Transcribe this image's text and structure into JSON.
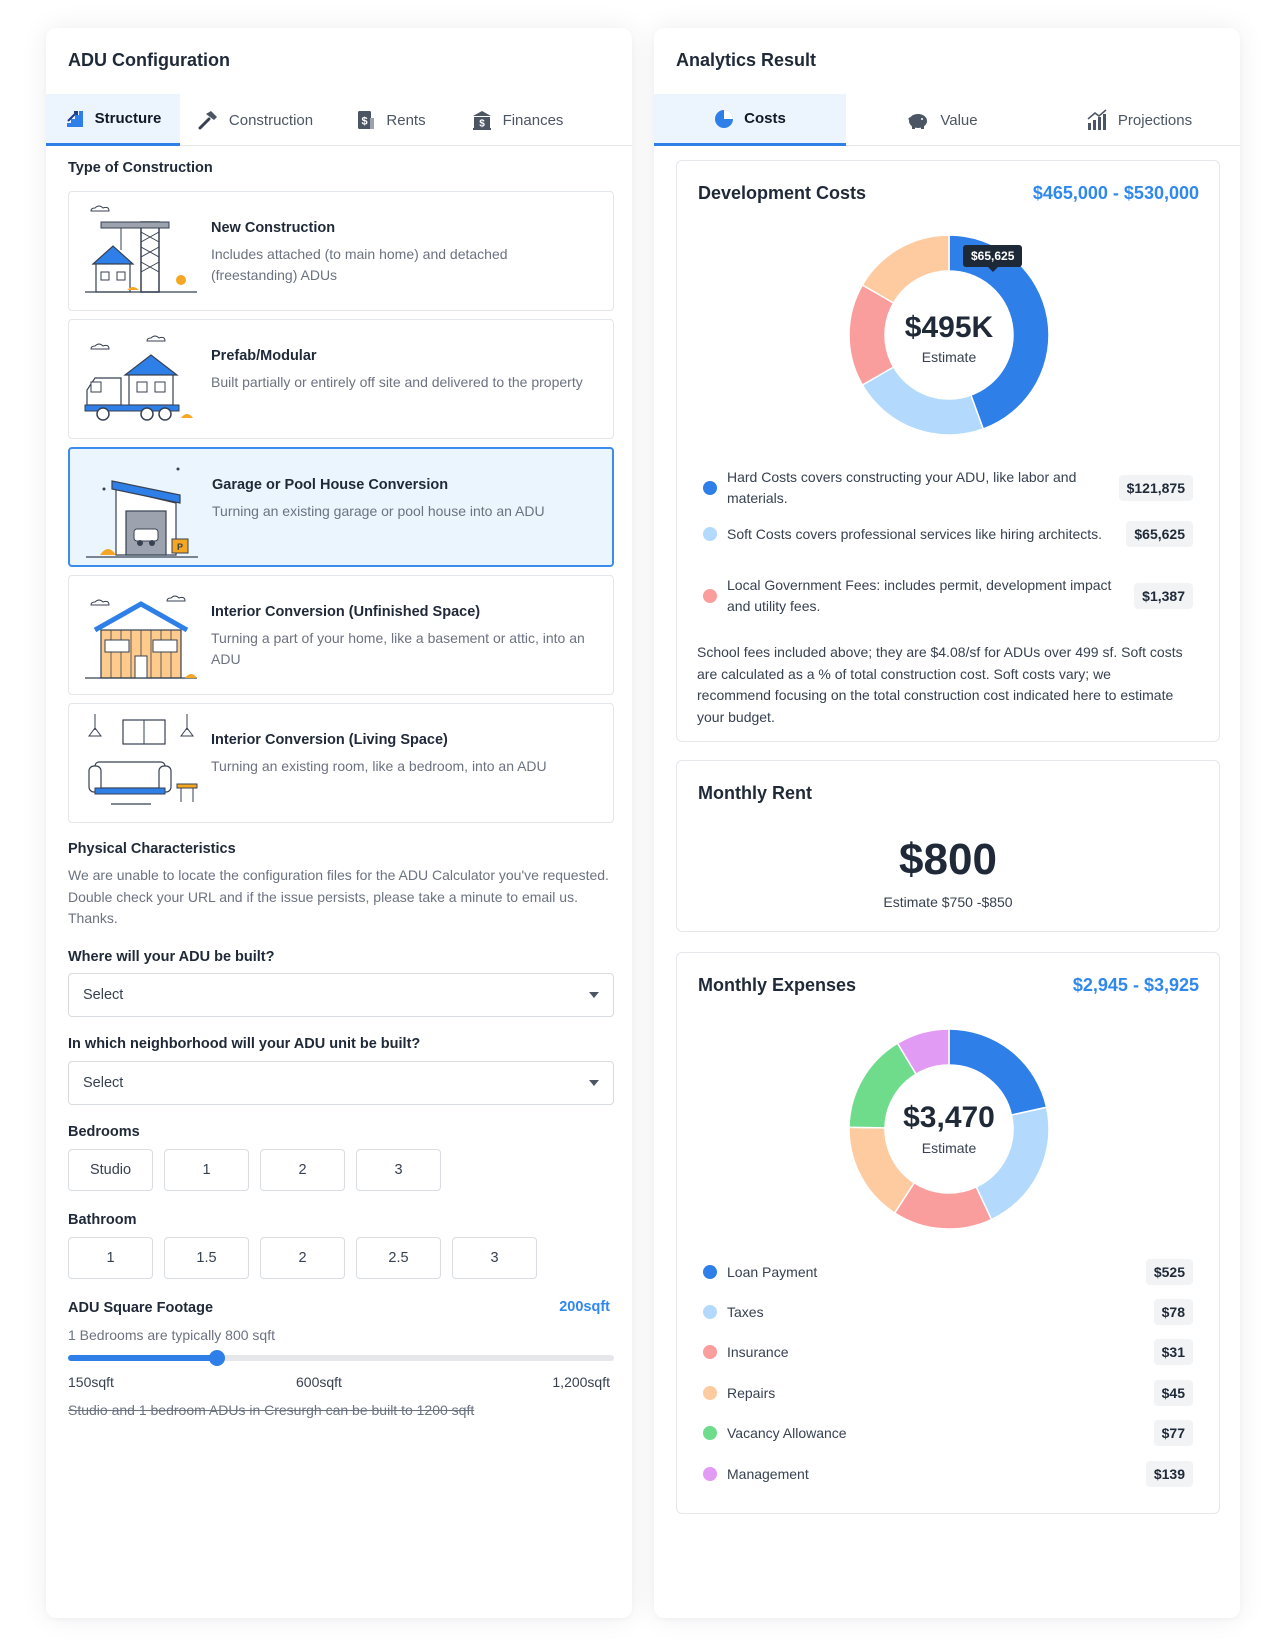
{
  "left": {
    "title": "ADU Configuration",
    "tabs": [
      {
        "label": "Structure",
        "icon": "stairs-icon"
      },
      {
        "label": "Construction",
        "icon": "hammer-icon"
      },
      {
        "label": "Rents",
        "icon": "dollar-document-icon"
      },
      {
        "label": "Finances",
        "icon": "bank-icon"
      }
    ],
    "type_label": "Type of Construction",
    "types": [
      {
        "title": "New Construction",
        "desc": "Includes attached (to main home) and detached (freestanding) ADUs"
      },
      {
        "title": "Prefab/Modular",
        "desc": "Built partially or entirely off site and delivered to the property"
      },
      {
        "title": "Garage or Pool House Conversion",
        "desc": "Turning an existing garage or pool house into an ADU"
      },
      {
        "title": "Interior Conversion (Unfinished Space)",
        "desc": "Turning a part of your home, like a basement or attic, into an ADU"
      },
      {
        "title": "Interior Conversion (Living Space)",
        "desc": "Turning an existing room, like a bedroom, into an ADU"
      }
    ],
    "physical_label": "Physical Characteristics",
    "physical_text": "We are unable to locate the configuration files for the ADU Calculator you've requested. Double check your URL and if the issue persists, please take a minute to email us. Thanks.",
    "where_label": "Where will your ADU be built?",
    "where_value": "Select",
    "neighborhood_label": "In which neighborhood will your ADU unit be built?",
    "neighborhood_value": "Select",
    "bedrooms_label": "Bedrooms",
    "bedrooms": [
      "Studio",
      "1",
      "2",
      "3"
    ],
    "bathroom_label": "Bathroom",
    "bathrooms": [
      "1",
      "1.5",
      "2",
      "2.5",
      "3"
    ],
    "sqft_label": "ADU Square Footage",
    "sqft_value": "200sqft",
    "sqft_hint": "1 Bedrooms are typically 800 sqft",
    "slider_fraction": 0.273,
    "slider_min": "150sqft",
    "slider_mid": "600sqft",
    "slider_max": "1,200sqft",
    "sqft_note": "Studio and 1 bedroom ADUs in Cresurgh can be built to 1200 sqft"
  },
  "right": {
    "title": "Analytics Result",
    "tabs": [
      {
        "label": "Costs",
        "icon": "pie-chart-icon"
      },
      {
        "label": "Value",
        "icon": "piggy-bank-icon"
      },
      {
        "label": "Projections",
        "icon": "bar-growth-icon"
      }
    ],
    "dev": {
      "title": "Development Costs",
      "range": "$465,000 - $530,000",
      "center_value": "$495K",
      "center_label": "Estimate",
      "tooltip": "$65,625",
      "items": [
        {
          "text": "Hard Costs covers constructing your ADU, like labor and materials.",
          "amount": "$121,875",
          "color": "#2f7fe8"
        },
        {
          "text": "Soft Costs covers professional services like hiring architects.",
          "amount": "$65,625",
          "color": "#b3dafc"
        },
        {
          "text": "Local Government Fees: includes permit, development impact and utility fees.",
          "amount": "$1,387",
          "color": "#fa9d9d"
        }
      ],
      "note": "School fees included above; they are $4.08/sf for ADUs over 499 sf. Soft costs are calculated as a % of total construction cost. Soft costs vary; we recommend focusing on the total construction cost indicated here to estimate your budget."
    },
    "rent": {
      "title": "Monthly Rent",
      "value": "$800",
      "estimate": "Estimate $750 -$850"
    },
    "expenses": {
      "title": "Monthly Expenses",
      "range": "$2,945 - $3,925",
      "center_value": "$3,470",
      "center_label": "Estimate",
      "items": [
        {
          "label": "Loan Payment",
          "amount": "$525",
          "color": "#2f7fe8"
        },
        {
          "label": "Taxes",
          "amount": "$78",
          "color": "#b3dafc"
        },
        {
          "label": "Insurance",
          "amount": "$31",
          "color": "#fa9d9d"
        },
        {
          "label": "Repairs",
          "amount": "$45",
          "color": "#fecba1"
        },
        {
          "label": "Vacancy Allowance",
          "amount": "$77",
          "color": "#6fdc8c"
        },
        {
          "label": "Management",
          "amount": "$139",
          "color": "#e19bf5"
        }
      ]
    }
  },
  "chart_data": [
    {
      "type": "pie",
      "title": "Development Costs",
      "segments": [
        {
          "name": "Hard Costs",
          "share": 0.4,
          "color": "#2f7fe8"
        },
        {
          "name": "Soft Costs",
          "share": 0.2,
          "color": "#b3dafc"
        },
        {
          "name": "Local Government Fees",
          "share": 0.15,
          "color": "#fa9d9d"
        },
        {
          "name": "",
          "share": 0.15,
          "color": "#fecba1"
        }
      ]
    },
    {
      "type": "pie",
      "title": "Monthly Expenses",
      "segments": [
        {
          "name": "Loan Payment",
          "share": 0.2,
          "color": "#2f7fe8"
        },
        {
          "name": "Taxes",
          "share": 0.2,
          "color": "#b3dafc"
        },
        {
          "name": "Insurance",
          "share": 0.15,
          "color": "#fa9d9d"
        },
        {
          "name": "Repairs",
          "share": 0.15,
          "color": "#fecba1"
        },
        {
          "name": "Vacancy Allowance",
          "share": 0.15,
          "color": "#6fdc8c"
        },
        {
          "name": "Management",
          "share": 0.08,
          "color": "#e19bf5"
        }
      ]
    }
  ]
}
